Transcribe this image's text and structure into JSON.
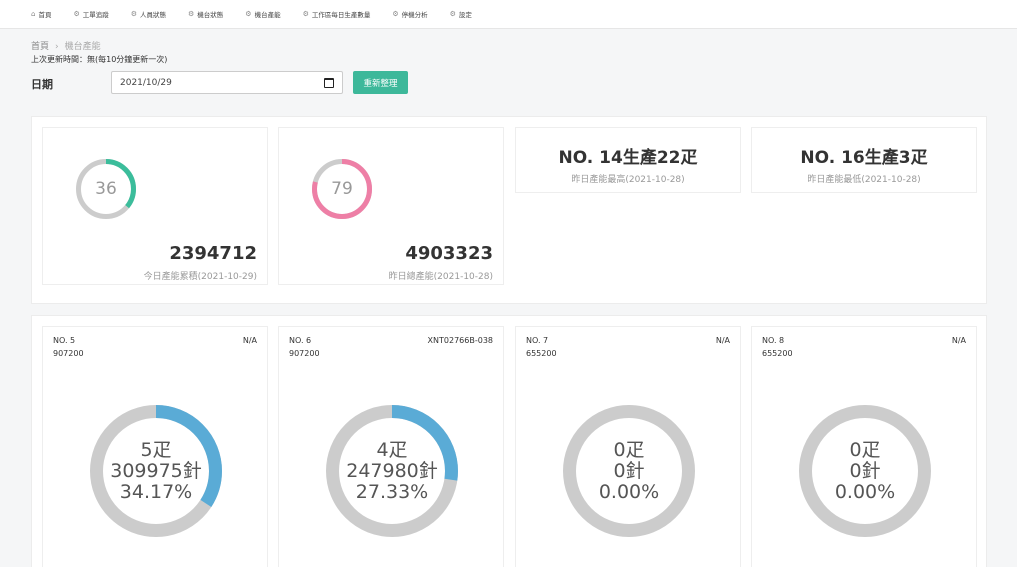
{
  "nav": [
    {
      "label": "首頁",
      "icon": "home-icon",
      "glyph": "⌂"
    },
    {
      "label": "工單追蹤",
      "icon": "gear-icon",
      "glyph": "⚙"
    },
    {
      "label": "人員狀態",
      "icon": "gear-icon",
      "glyph": "⚙"
    },
    {
      "label": "機台狀態",
      "icon": "gear-icon",
      "glyph": "⚙"
    },
    {
      "label": "機台產能",
      "icon": "gear-icon",
      "glyph": "⚙"
    },
    {
      "label": "工作區每日生產數量",
      "icon": "gear-icon",
      "glyph": "⚙"
    },
    {
      "label": "停機分析",
      "icon": "gear-icon",
      "glyph": "⚙"
    },
    {
      "label": "設定",
      "icon": "gear-icon",
      "glyph": "⚙"
    }
  ],
  "breadcrumb": {
    "home": "首頁",
    "sep": "›",
    "current": "機台產能"
  },
  "updated_text": "上次更新時間：無(每10分鐘更新一次)",
  "date": {
    "label": "日期",
    "value": "2021/10/29",
    "icon": "calendar-icon"
  },
  "refresh_label": "重新整理",
  "colors": {
    "accent": "#3db89a",
    "teal": "#3bbd9b",
    "pink": "#ee7fa6",
    "blue": "#5aabd6",
    "track": "#cccccc"
  },
  "summary": [
    {
      "ring_value": "36",
      "ring_percent": 36,
      "ring_color": "#3bbd9b",
      "value": "2394712",
      "label": "今日產能累積(2021-10-29)"
    },
    {
      "ring_value": "79",
      "ring_percent": 79,
      "ring_color": "#ee7fa6",
      "value": "4903323",
      "label": "昨日總產能(2021-10-28)"
    }
  ],
  "ranks": [
    {
      "title": "NO. 14生產22疋",
      "sub": "昨日產能最高(2021-10-28)"
    },
    {
      "title": "NO. 16生產3疋",
      "sub": "昨日產能最低(2021-10-28)"
    }
  ],
  "machines": [
    {
      "no": "NO. 5",
      "code": "907200",
      "status": "N/A",
      "line1": "5疋",
      "line2": "309975針",
      "line3": "34.17%",
      "percent": 34.17
    },
    {
      "no": "NO. 6",
      "code": "907200",
      "status": "XNT02766B-038",
      "line1": "4疋",
      "line2": "247980針",
      "line3": "27.33%",
      "percent": 27.33
    },
    {
      "no": "NO. 7",
      "code": "655200",
      "status": "N/A",
      "line1": "0疋",
      "line2": "0針",
      "line3": "0.00%",
      "percent": 0
    },
    {
      "no": "NO. 8",
      "code": "655200",
      "status": "N/A",
      "line1": "0疋",
      "line2": "0針",
      "line3": "0.00%",
      "percent": 0
    }
  ]
}
